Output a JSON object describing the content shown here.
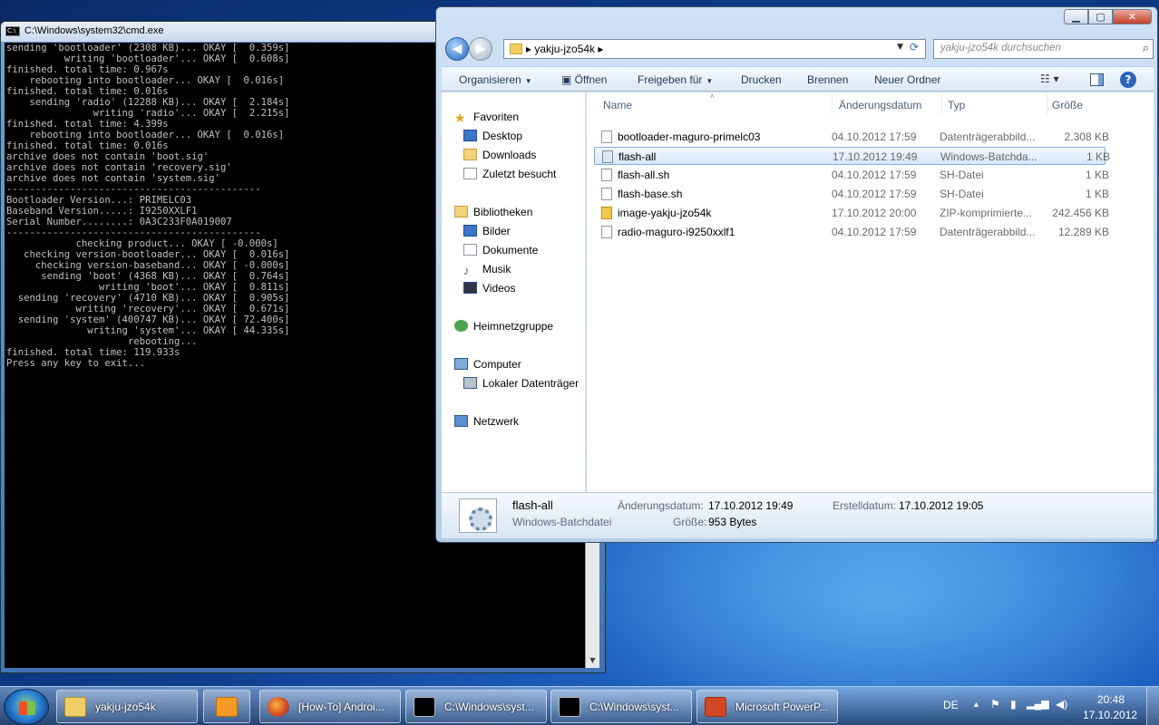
{
  "cmd": {
    "title": "C:\\Windows\\system32\\cmd.exe",
    "lines": [
      "sending 'bootloader' (2308 KB)... OKAY [  0.359s]",
      "          writing 'bootloader'... OKAY [  0.608s]",
      "finished. total time: 0.967s",
      "    rebooting into bootloader... OKAY [  0.016s]",
      "finished. total time: 0.016s",
      "    sending 'radio' (12288 KB)... OKAY [  2.184s]",
      "               writing 'radio'... OKAY [  2.215s]",
      "finished. total time: 4.399s",
      "    rebooting into bootloader... OKAY [  0.016s]",
      "finished. total time: 0.016s",
      "archive does not contain 'boot.sig'",
      "archive does not contain 'recovery.sig'",
      "archive does not contain 'system.sig'",
      "--------------------------------------------",
      "Bootloader Version...: PRIMELC03",
      "Baseband Version.....: I9250XXLF1",
      "Serial Number........: 0A3C233F0A019007",
      "--------------------------------------------",
      "            checking product... OKAY [ -0.000s]",
      "   checking version-bootloader... OKAY [  0.016s]",
      "     checking version-baseband... OKAY [ -0.000s]",
      "      sending 'boot' (4368 KB)... OKAY [  0.764s]",
      "                writing 'boot'... OKAY [  0.811s]",
      "  sending 'recovery' (4710 KB)... OKAY [  0.905s]",
      "            writing 'recovery'... OKAY [  0.671s]",
      "  sending 'system' (400747 KB)... OKAY [ 72.400s]",
      "              writing 'system'... OKAY [ 44.335s]",
      "                     rebooting...",
      "finished. total time: 119.933s",
      "Press any key to exit..."
    ]
  },
  "explorer": {
    "breadcrumb": "yakju-jzo54k",
    "search_placeholder": "yakju-jzo54k durchsuchen",
    "toolbar": {
      "organize": "Organisieren",
      "open": "Öffnen",
      "share": "Freigeben für",
      "print": "Drucken",
      "burn": "Brennen",
      "new_folder": "Neuer Ordner"
    },
    "nav": {
      "favorites": "Favoriten",
      "desktop": "Desktop",
      "downloads": "Downloads",
      "recent": "Zuletzt besucht",
      "libraries": "Bibliotheken",
      "pictures": "Bilder",
      "documents": "Dokumente",
      "music": "Musik",
      "videos": "Videos",
      "homegroup": "Heimnetzgruppe",
      "computer": "Computer",
      "local_disk": "Lokaler Datenträger",
      "network": "Netzwerk"
    },
    "columns": {
      "name": "Name",
      "date": "Änderungsdatum",
      "type": "Typ",
      "size": "Größe"
    },
    "files": [
      {
        "name": "bootloader-maguro-primelc03",
        "date": "04.10.2012 17:59",
        "type": "Datenträgerabbild...",
        "size": "2.308 KB",
        "icon": "file-icon"
      },
      {
        "name": "flash-all",
        "date": "17.10.2012 19:49",
        "type": "Windows-Batchda...",
        "size": "1 KB",
        "icon": "batch-gear-icon"
      },
      {
        "name": "flash-all.sh",
        "date": "04.10.2012 17:59",
        "type": "SH-Datei",
        "size": "1 KB",
        "icon": "file-icon"
      },
      {
        "name": "flash-base.sh",
        "date": "04.10.2012 17:59",
        "type": "SH-Datei",
        "size": "1 KB",
        "icon": "file-icon"
      },
      {
        "name": "image-yakju-jzo54k",
        "date": "17.10.2012 20:00",
        "type": "ZIP-komprimierte...",
        "size": "242.456 KB",
        "icon": "zip-folder-icon"
      },
      {
        "name": "radio-maguro-i9250xxlf1",
        "date": "04.10.2012 17:59",
        "type": "Datenträgerabbild...",
        "size": "12.289 KB",
        "icon": "file-icon"
      }
    ],
    "details": {
      "name": "flash-all",
      "type": "Windows-Batchdatei",
      "mod_label": "Änderungsdatum:",
      "mod_value": "17.10.2012 19:49",
      "created_label": "Erstelldatum:",
      "created_value": "17.10.2012 19:05",
      "size_label": "Größe:",
      "size_value": "953 Bytes"
    }
  },
  "taskbar": {
    "buttons": [
      {
        "label": "yakju-jzo54k",
        "icon": "folder-icon"
      },
      {
        "label": "",
        "icon": "media-player-icon"
      },
      {
        "label": "[How-To] Androi...",
        "icon": "firefox-icon"
      },
      {
        "label": "C:\\Windows\\syst...",
        "icon": "cmd-icon"
      },
      {
        "label": "C:\\Windows\\syst...",
        "icon": "cmd-icon"
      },
      {
        "label": "Microsoft PowerP...",
        "icon": "powerpoint-icon"
      }
    ],
    "lang": "DE",
    "time": "20:48",
    "date": "17.10.2012"
  }
}
